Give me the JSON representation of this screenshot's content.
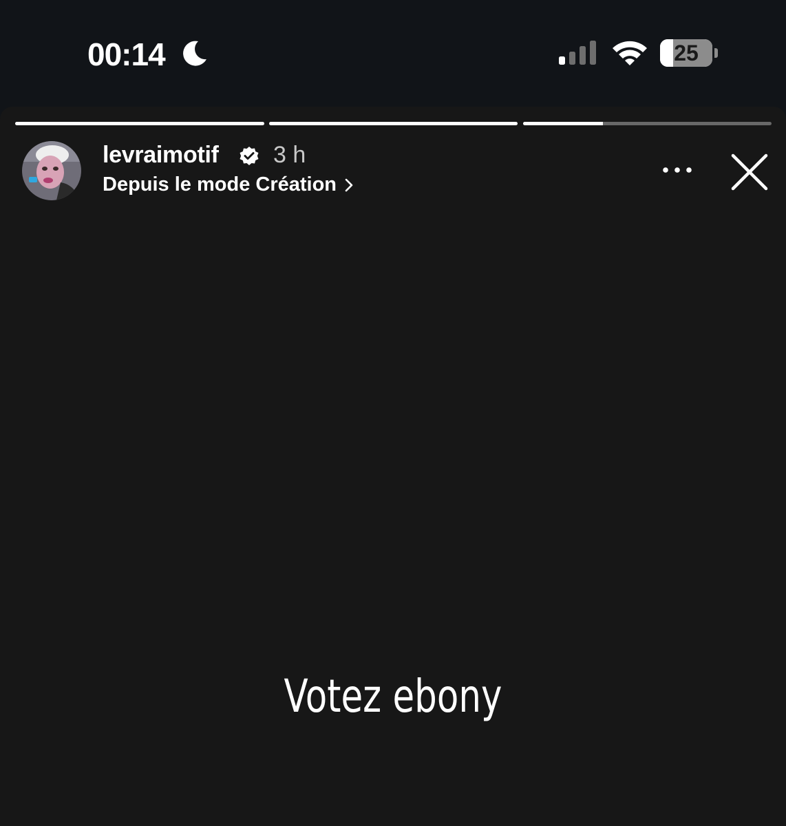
{
  "status_bar": {
    "time": "00:14",
    "focus_icon": "moon-icon",
    "signal_icon": "cellular-signal-icon",
    "wifi_icon": "wifi-icon",
    "battery_percent": "25",
    "battery_level": 0.25
  },
  "story": {
    "progress": [
      1.0,
      1.0,
      0.32
    ],
    "header": {
      "username": "levraimotif",
      "verified_icon": "verified-badge-icon",
      "time_ago": "3 h",
      "subtitle": "Depuis le mode Création",
      "subtitle_icon": "chevron-right-icon",
      "more_icon": "more-options-icon",
      "close_icon": "close-icon"
    },
    "text": "Votez ebony",
    "background_color": "#171717"
  }
}
